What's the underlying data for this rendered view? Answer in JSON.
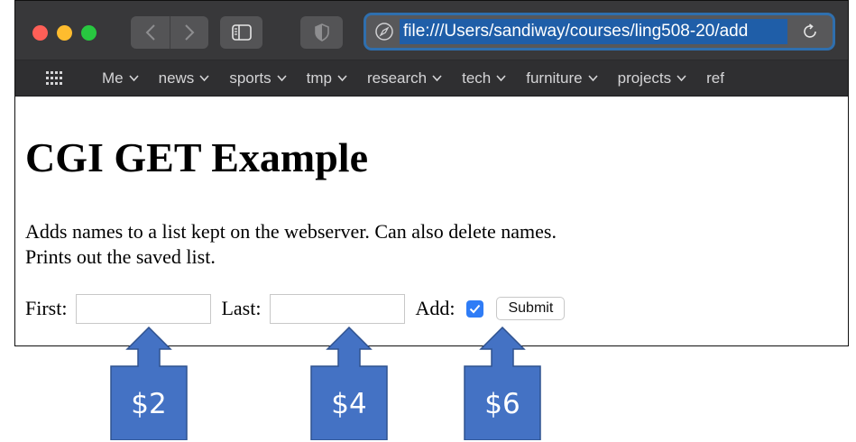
{
  "browser": {
    "url": "file:///Users/sandiway/courses/ling508-20/add",
    "favorites": [
      {
        "label": "Me"
      },
      {
        "label": "news"
      },
      {
        "label": "sports"
      },
      {
        "label": "tmp"
      },
      {
        "label": "research"
      },
      {
        "label": "tech"
      },
      {
        "label": "furniture"
      },
      {
        "label": "projects"
      },
      {
        "label": "ref"
      }
    ],
    "icons": {
      "back": "chevron-left-icon",
      "forward": "chevron-right-icon",
      "sidebar": "sidebar-icon",
      "privacy": "shield-icon",
      "address": "compass-icon",
      "reload": "reload-icon",
      "favorites": "grid-icon"
    },
    "colors": {
      "url_highlight": "#1f5ea8",
      "address_border": "#2f6fae",
      "checkbox": "#2f7cf6",
      "callout": "#4472c4"
    }
  },
  "page": {
    "title": "CGI GET Example",
    "description_line1": "Adds names to a list kept on the webserver. Can also delete names.",
    "description_line2": "Prints out the saved list.",
    "form": {
      "first_label": "First:",
      "first_value": "",
      "last_label": "Last:",
      "last_value": "",
      "add_label": "Add:",
      "add_checked": true,
      "submit_label": "Submit"
    }
  },
  "annotations": [
    {
      "label": "$2"
    },
    {
      "label": "$4"
    },
    {
      "label": "$6"
    }
  ]
}
